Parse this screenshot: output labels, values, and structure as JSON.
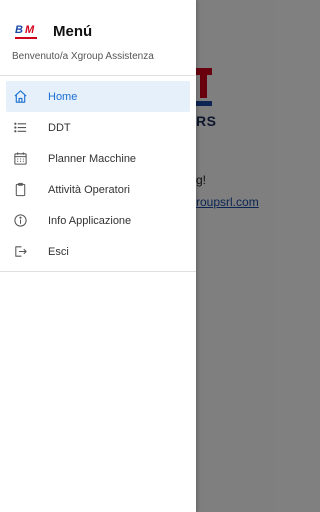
{
  "background": {
    "logo_text": "RS",
    "text_line": "g!",
    "link_text": "roupsrl.com"
  },
  "drawer": {
    "logo": {
      "letter_b": "B",
      "letter_m": "M"
    },
    "title": "Menú",
    "subtitle": "Benvenuto/a Xgroup Assistenza",
    "items": [
      {
        "label": "Home",
        "icon": "home-icon",
        "active": true
      },
      {
        "label": "DDT",
        "icon": "list-icon",
        "active": false
      },
      {
        "label": "Planner Macchine",
        "icon": "calendar-icon",
        "active": false
      },
      {
        "label": "Attività Operatori",
        "icon": "clipboard-icon",
        "active": false
      },
      {
        "label": "Info Applicazione",
        "icon": "info-icon",
        "active": false
      },
      {
        "label": "Esci",
        "icon": "logout-icon",
        "active": false
      }
    ]
  },
  "colors": {
    "accent": "#1a6fd1",
    "active_bg": "#e6f0fb",
    "brand_red": "#d0021b",
    "brand_blue": "#1a4aa5"
  }
}
